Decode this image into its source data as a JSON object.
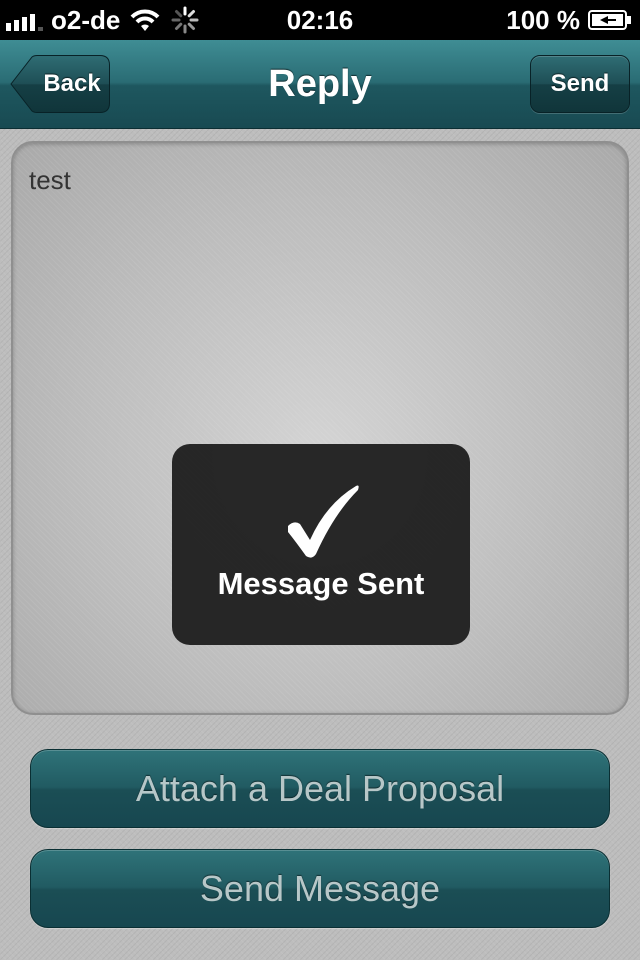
{
  "status_bar": {
    "carrier": "o2-de",
    "time": "02:16",
    "battery_percent": "100 %",
    "icons": [
      "signal-icon",
      "wifi-icon",
      "activity-spinner-icon",
      "battery-charging-icon"
    ]
  },
  "nav_bar": {
    "back_label": "Back",
    "title": "Reply",
    "send_label": "Send"
  },
  "message": {
    "text": "test"
  },
  "hud": {
    "icon": "checkmark-icon",
    "label": "Message Sent"
  },
  "actions": {
    "attach_label": "Attach a Deal Proposal",
    "send_message_label": "Send Message"
  },
  "colors": {
    "nav_teal": "#2a6c74",
    "button_teal": "#215b62",
    "hud_bg": "#1e1e1e"
  }
}
